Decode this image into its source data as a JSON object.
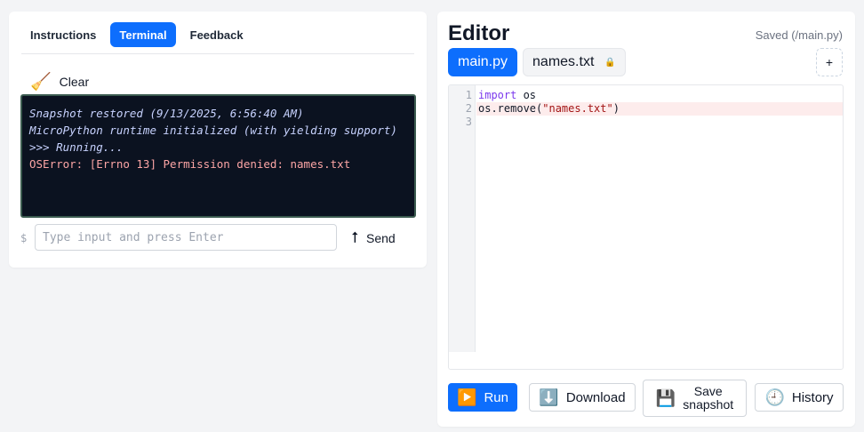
{
  "left": {
    "tabs": [
      {
        "label": "Instructions"
      },
      {
        "label": "Terminal"
      },
      {
        "label": "Feedback"
      }
    ],
    "clear": {
      "icon": "broom-icon",
      "glyph": "🧹",
      "label": "Clear"
    },
    "terminal_lines": [
      "Snapshot restored (9/13/2025, 6:56:40 AM)",
      "MicroPython runtime initialized (with yielding support)",
      ">>> Running...",
      "OSError: [Errno 13] Permission denied: names.txt"
    ],
    "prompt": {
      "symbol": "$",
      "placeholder": "Type input and press Enter",
      "value": ""
    },
    "send": {
      "icon": "arrow-up-icon",
      "glyph": "⭡",
      "label": "Send"
    }
  },
  "editor": {
    "title": "Editor",
    "status": "Saved (/main.py)",
    "files": [
      {
        "name": "main.py",
        "locked": false
      },
      {
        "name": "names.txt",
        "locked": true,
        "lock_glyph": "🔒"
      }
    ],
    "add_label": "+",
    "line_numbers": [
      "1",
      "2",
      "3"
    ],
    "code": {
      "l1_kw": "import",
      "l1_rest": " os",
      "l2_pre": "os.remove(",
      "l2_str": "\"names.txt\"",
      "l2_post": ")",
      "l3": ""
    },
    "actions": {
      "run": {
        "icon": "play-icon",
        "glyph": "▶️",
        "label": "Run"
      },
      "download": {
        "icon": "download-icon",
        "glyph": "⬇️",
        "label": "Download"
      },
      "save": {
        "icon": "floppy-disk-icon",
        "glyph": "💾",
        "line1": "Save",
        "line2": "snapshot"
      },
      "history": {
        "icon": "clock-icon",
        "glyph": "🕘",
        "label": "History"
      }
    }
  },
  "colors": {
    "accent": "#0d6efd",
    "terminal_bg": "#0b1220",
    "error_text": "#fca5a5"
  }
}
